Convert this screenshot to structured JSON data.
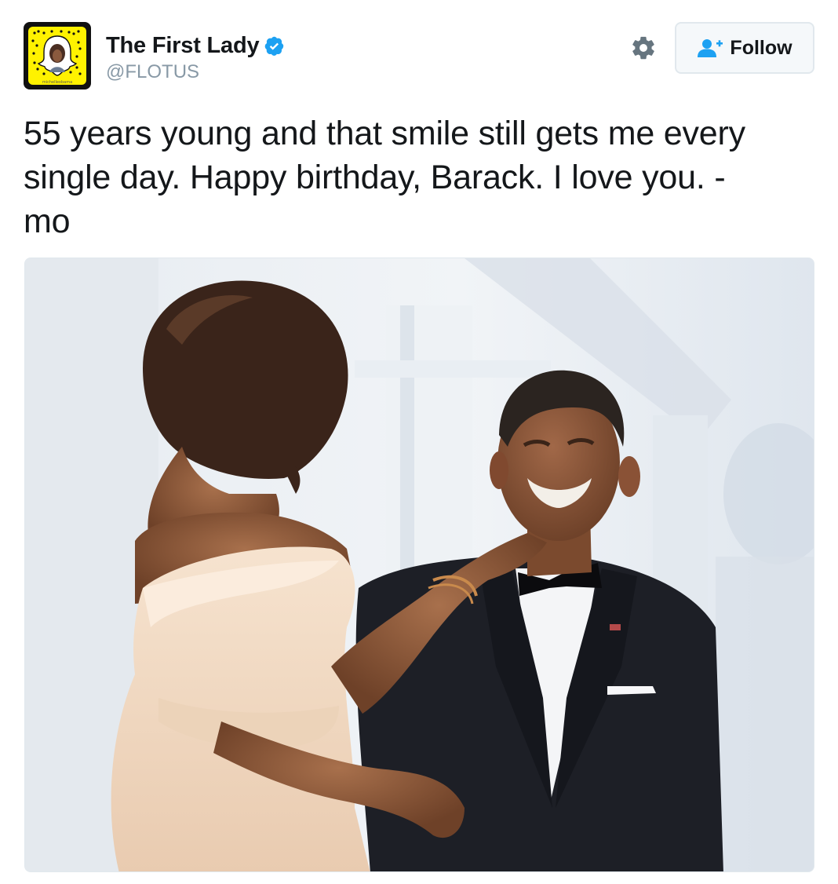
{
  "user": {
    "display_name": "The First Lady",
    "handle": "@FLOTUS",
    "verified": true,
    "avatar_caption": "michelleobama",
    "avatar_icon": "snapcode-avatar-icon",
    "verified_icon": "verified-badge-icon"
  },
  "actions": {
    "settings_icon": "gear-icon",
    "follow_label": "Follow",
    "follow_icon": "add-user-icon"
  },
  "tweet": {
    "text": "55 years young and that smile still gets me every single day. Happy birthday, Barack. I love you. -mo",
    "line1": "55 years young and that smile still gets me every",
    "line2": "single day. Happy birthday, Barack. I love you. -",
    "line3": "mo"
  },
  "colors": {
    "verified_blue": "#1da1f2",
    "text": "#14171a",
    "muted": "#8899a6",
    "follow_icon_blue": "#1da1f2",
    "snapcode_yellow": "#fff200"
  }
}
